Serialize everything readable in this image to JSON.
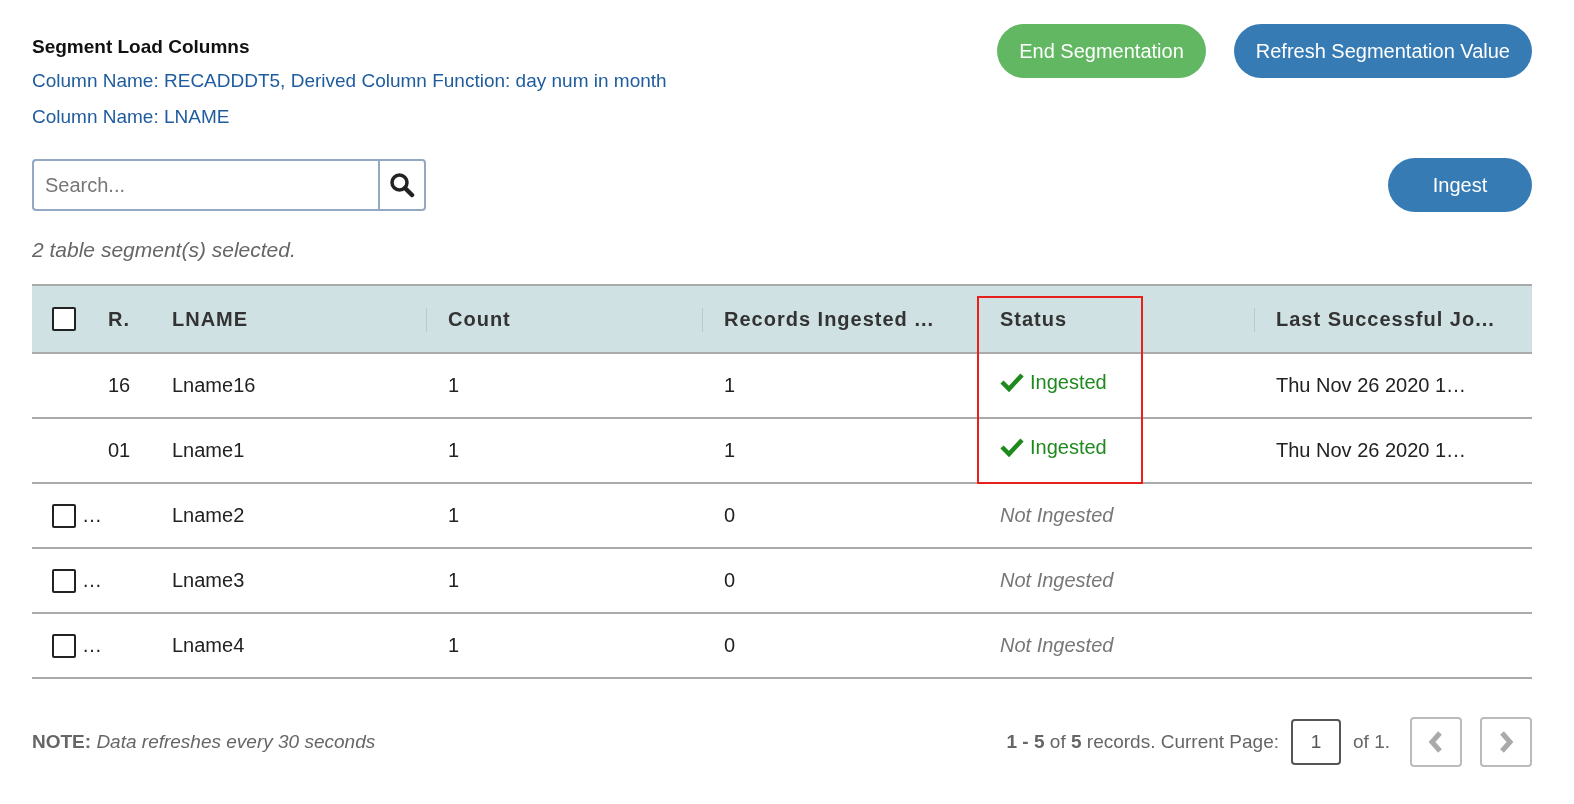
{
  "heading": "Segment Load Columns",
  "column_lines": [
    "Column Name: RECADDDT5, Derived Column Function: day num in month",
    "Column Name: LNAME"
  ],
  "buttons": [
    {
      "label": "End Segmentation",
      "kind": "success"
    },
    {
      "label": "Refresh Segmentation Value",
      "kind": "primary"
    }
  ],
  "search": {
    "placeholder": "Search..."
  },
  "ingest_button": {
    "label": "Ingest"
  },
  "selection_note": "2 table segment(s) selected.",
  "table": {
    "select_all": {
      "checked": false
    },
    "columns": [
      {
        "label": "R."
      },
      {
        "label": "LNAME"
      },
      {
        "label": "Count"
      },
      {
        "label": "Records Ingested ..."
      },
      {
        "label": "Status"
      },
      {
        "label": "Last Successful Jo..."
      }
    ],
    "rows": [
      {
        "kind": "ingested",
        "r": "16",
        "lname": "Lname16",
        "count": "1",
        "records": "1",
        "status": "Ingested",
        "last": "Thu Nov 26 2020 1…"
      },
      {
        "kind": "ingested",
        "r": "01",
        "lname": "Lname1",
        "count": "1",
        "records": "1",
        "status": "Ingested",
        "last": "Thu Nov 26 2020 1…"
      },
      {
        "kind": "pending",
        "checked": false,
        "r": "…",
        "lname": "Lname2",
        "count": "1",
        "records": "0",
        "status": "Not Ingested"
      },
      {
        "kind": "pending",
        "checked": false,
        "r": "…",
        "lname": "Lname3",
        "count": "1",
        "records": "0",
        "status": "Not Ingested"
      },
      {
        "kind": "pending",
        "checked": false,
        "r": "…",
        "lname": "Lname4",
        "count": "1",
        "records": "0",
        "status": "Not Ingested"
      }
    ]
  },
  "note": {
    "label": "NOTE:",
    "text": "Data refreshes every 30 seconds"
  },
  "pagination": {
    "summary": "**1 - 5** of **5** records. Current Page:",
    "page": "1",
    "of_text": "of 1.",
    "prev_disabled": true,
    "next_disabled": true
  }
}
